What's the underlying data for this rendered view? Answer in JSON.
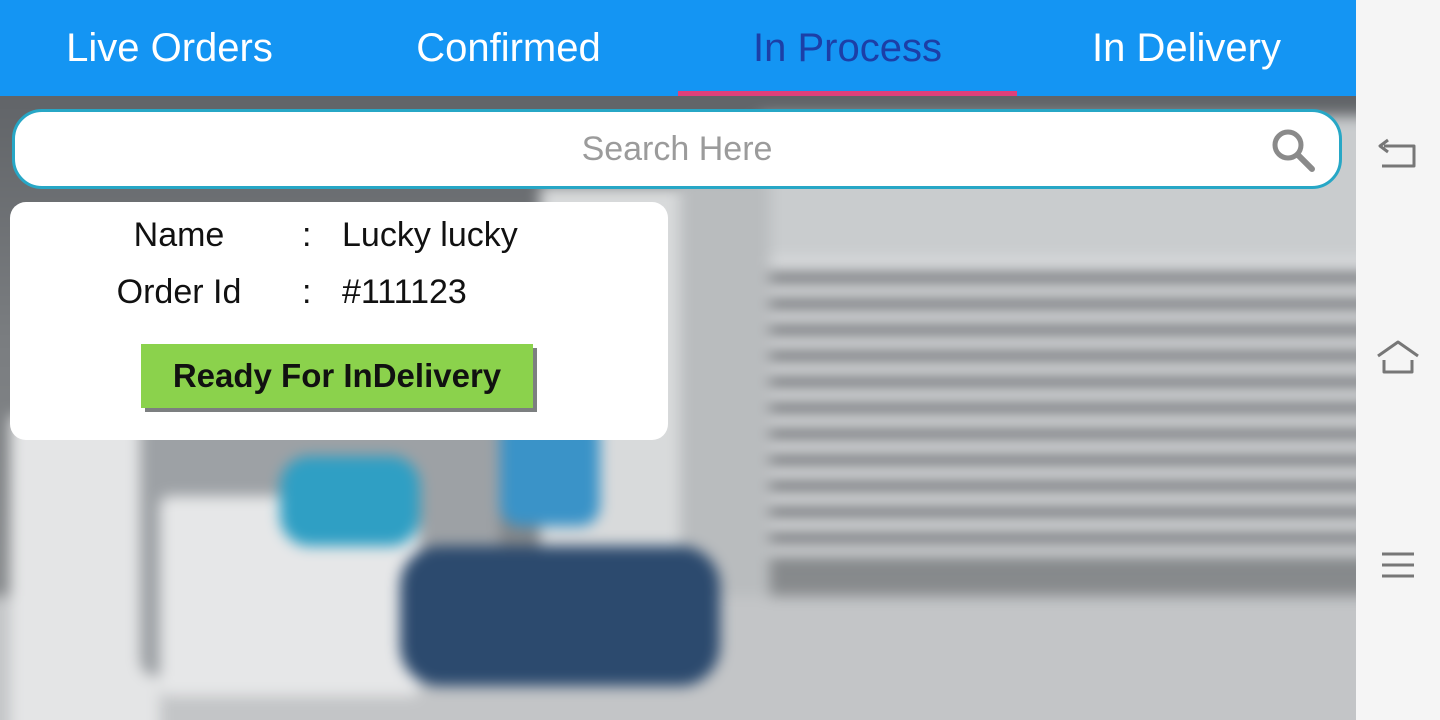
{
  "tabs": [
    {
      "label": "Live Orders",
      "active": false
    },
    {
      "label": "Confirmed",
      "active": false
    },
    {
      "label": "In Process",
      "active": true
    },
    {
      "label": "In Delivery",
      "active": false
    }
  ],
  "colors": {
    "tab_bar": "#1495f3",
    "active_tab_text": "#1c3fa7",
    "active_tab_underline": "#e0407a",
    "search_border": "#27a7c6",
    "action_button": "#8bd24c"
  },
  "search": {
    "placeholder": "Search Here",
    "value": "",
    "icon": "search-icon"
  },
  "order": {
    "name_label": "Name",
    "name_value": "Lucky lucky",
    "order_id_label": "Order Id",
    "order_id_value": "#111123",
    "separator": ":",
    "action_label": "Ready For InDelivery"
  },
  "nav": {
    "icons": [
      "back-icon",
      "home-icon",
      "menu-icon"
    ]
  }
}
